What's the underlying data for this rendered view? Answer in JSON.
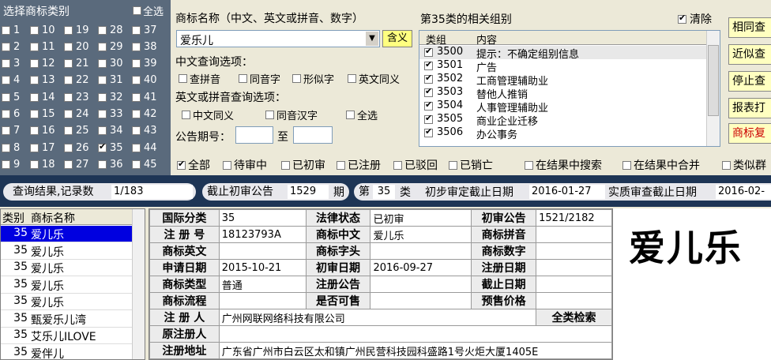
{
  "class_panel": {
    "title": "选择商标类别",
    "select_all": "全选",
    "columns": [
      [
        "1",
        "2",
        "3",
        "4",
        "5",
        "6",
        "7",
        "8",
        "9"
      ],
      [
        "10",
        "11",
        "12",
        "13",
        "14",
        "15",
        "16",
        "17",
        "18"
      ],
      [
        "19",
        "20",
        "21",
        "22",
        "23",
        "24",
        "25",
        "26",
        "27"
      ],
      [
        "28",
        "29",
        "30",
        "31",
        "32",
        "33",
        "34",
        "35",
        "36"
      ],
      [
        "37",
        "38",
        "39",
        "40",
        "41",
        "42",
        "43",
        "44",
        "45"
      ]
    ],
    "checked": [
      "35"
    ]
  },
  "search": {
    "name_label": "商标名称（中文、英文或拼音、数字）",
    "name_value": "爱乐儿",
    "meaning_button": "含义",
    "cn_options_label": "中文查询选项：",
    "cn_options": [
      "查拼音",
      "同音字",
      "形似字",
      "英文同义"
    ],
    "en_options_label": "英文或拼音查询选项：",
    "en_options": [
      "中文同义",
      "同音汉字",
      "全选"
    ],
    "issue_label": "公告期号：",
    "to_label": "至"
  },
  "groups": {
    "title": "第35类的相关组别",
    "clear_label": "清除",
    "col_group": "类组",
    "col_content": "内容",
    "rows": [
      {
        "id": "3500",
        "text": "提示：不确定组别信息"
      },
      {
        "id": "3501",
        "text": "广告"
      },
      {
        "id": "3502",
        "text": "工商管理辅助业"
      },
      {
        "id": "3503",
        "text": "替他人推销"
      },
      {
        "id": "3504",
        "text": "人事管理辅助业"
      },
      {
        "id": "3505",
        "text": "商业企业迁移"
      },
      {
        "id": "3506",
        "text": "办公事务"
      }
    ]
  },
  "right_buttons": [
    "相同查",
    "近似查",
    "停止查",
    "报表打",
    "商标复"
  ],
  "filters": [
    "全部",
    "待审中",
    "已初审",
    "已注册",
    "已驳回",
    "已销亡",
    "在结果中搜索",
    "在结果中合并",
    "类似群"
  ],
  "status": {
    "result_label": "查询结果,记录数",
    "result_value": "1/183",
    "deadline_label": "截止初审公告",
    "deadline_value": "1529",
    "deadline_unit": "期",
    "class_prefix": "第",
    "class_value": "35",
    "class_suffix": "类",
    "prelim_label": "初步审定截止日期",
    "prelim_value": "2016-01-27",
    "substantive_label": "实质审查截止日期",
    "substantive_value": "2016-02-"
  },
  "results": {
    "col_class": "类别",
    "col_name": "商标名称",
    "rows": [
      {
        "cls": "35",
        "name": "爱儿乐"
      },
      {
        "cls": "35",
        "name": "爱儿乐"
      },
      {
        "cls": "35",
        "name": "爱儿乐"
      },
      {
        "cls": "35",
        "name": "爱儿乐"
      },
      {
        "cls": "35",
        "name": "爱儿乐"
      },
      {
        "cls": "35",
        "name": "甄爱乐儿湾"
      },
      {
        "cls": "35",
        "name": "艾乐儿ILOVE"
      },
      {
        "cls": "35",
        "name": "爱伴儿"
      }
    ]
  },
  "detail": {
    "k_intl": "国际分类",
    "v_intl": "35",
    "k_legal": "法律状态",
    "v_legal": "已初审",
    "k_prelim": "初审公告",
    "v_prelim": "1521/2182",
    "k_regno": "注 册 号",
    "v_regno": "18123793A",
    "k_cn": "商标中文",
    "v_cn": "爱儿乐",
    "k_py": "商标拼音",
    "v_py": "",
    "k_en": "商标英文",
    "v_en": "",
    "k_head": "商标字头",
    "v_head": "",
    "k_num": "商标数字",
    "v_num": "",
    "k_apply": "申请日期",
    "v_apply": "2015-10-21",
    "k_prelimdate": "初审日期",
    "v_prelimdate": "2016-09-27",
    "k_regdate": "注册日期",
    "v_regdate": "",
    "k_type": "商标类型",
    "v_type": "普通",
    "k_regnotice": "注册公告",
    "v_regnotice": "",
    "k_end": "截止日期",
    "v_end": "",
    "k_flow": "商标流程",
    "v_flow": "",
    "k_sale": "是否可售",
    "v_sale": "",
    "k_presale": "预售价格",
    "v_presale": "",
    "k_reg": "注 册 人",
    "v_reg": "广州网联网络科技有限公司",
    "all_search": "全类检索",
    "k_orig": "原注册人",
    "v_orig": "",
    "k_addr": "注册地址",
    "v_addr": "广东省广州市白云区太和镇广州民营科技园科盛路1号火炬大厦1405E"
  },
  "logo_text": "爱儿乐"
}
